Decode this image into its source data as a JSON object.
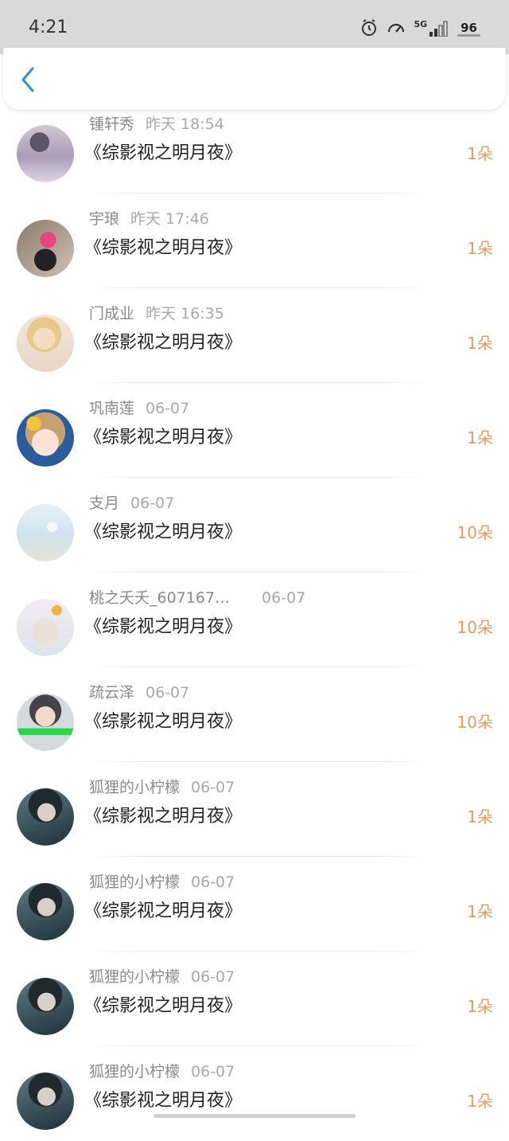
{
  "status_bar": {
    "time": "4:21",
    "network": "5G",
    "battery": "96"
  },
  "nav": {
    "back_icon": "chevron-left-icon",
    "accent": "#2f8de4"
  },
  "colors": {
    "amount": "#e89a5a",
    "meta": "#8a8a8a"
  },
  "rows": [
    {
      "name": "锺轩秀",
      "time": "昨天 18:54",
      "title": "《综影视之明月夜》",
      "amount": "1朵"
    },
    {
      "name": "宇琅",
      "time": "昨天 17:46",
      "title": "《综影视之明月夜》",
      "amount": "1朵"
    },
    {
      "name": "门成业",
      "time": "昨天 16:35",
      "title": "《综影视之明月夜》",
      "amount": "1朵"
    },
    {
      "name": "巩南莲",
      "time": "06-07",
      "title": "《综影视之明月夜》",
      "amount": "1朵"
    },
    {
      "name": "支月",
      "time": "06-07",
      "title": "《综影视之明月夜》",
      "amount": "10朵"
    },
    {
      "name": "桃之夭夭_607167…",
      "time": "06-07",
      "title": "《综影视之明月夜》",
      "amount": "10朵"
    },
    {
      "name": "疏云泽",
      "time": "06-07",
      "title": "《综影视之明月夜》",
      "amount": "10朵"
    },
    {
      "name": "狐狸的小柠檬",
      "time": "06-07",
      "title": "《综影视之明月夜》",
      "amount": "1朵"
    },
    {
      "name": "狐狸的小柠檬",
      "time": "06-07",
      "title": "《综影视之明月夜》",
      "amount": "1朵"
    },
    {
      "name": "狐狸的小柠檬",
      "time": "06-07",
      "title": "《综影视之明月夜》",
      "amount": "1朵"
    },
    {
      "name": "狐狸的小柠檬",
      "time": "06-07",
      "title": "《综影视之明月夜》",
      "amount": "1朵"
    }
  ]
}
